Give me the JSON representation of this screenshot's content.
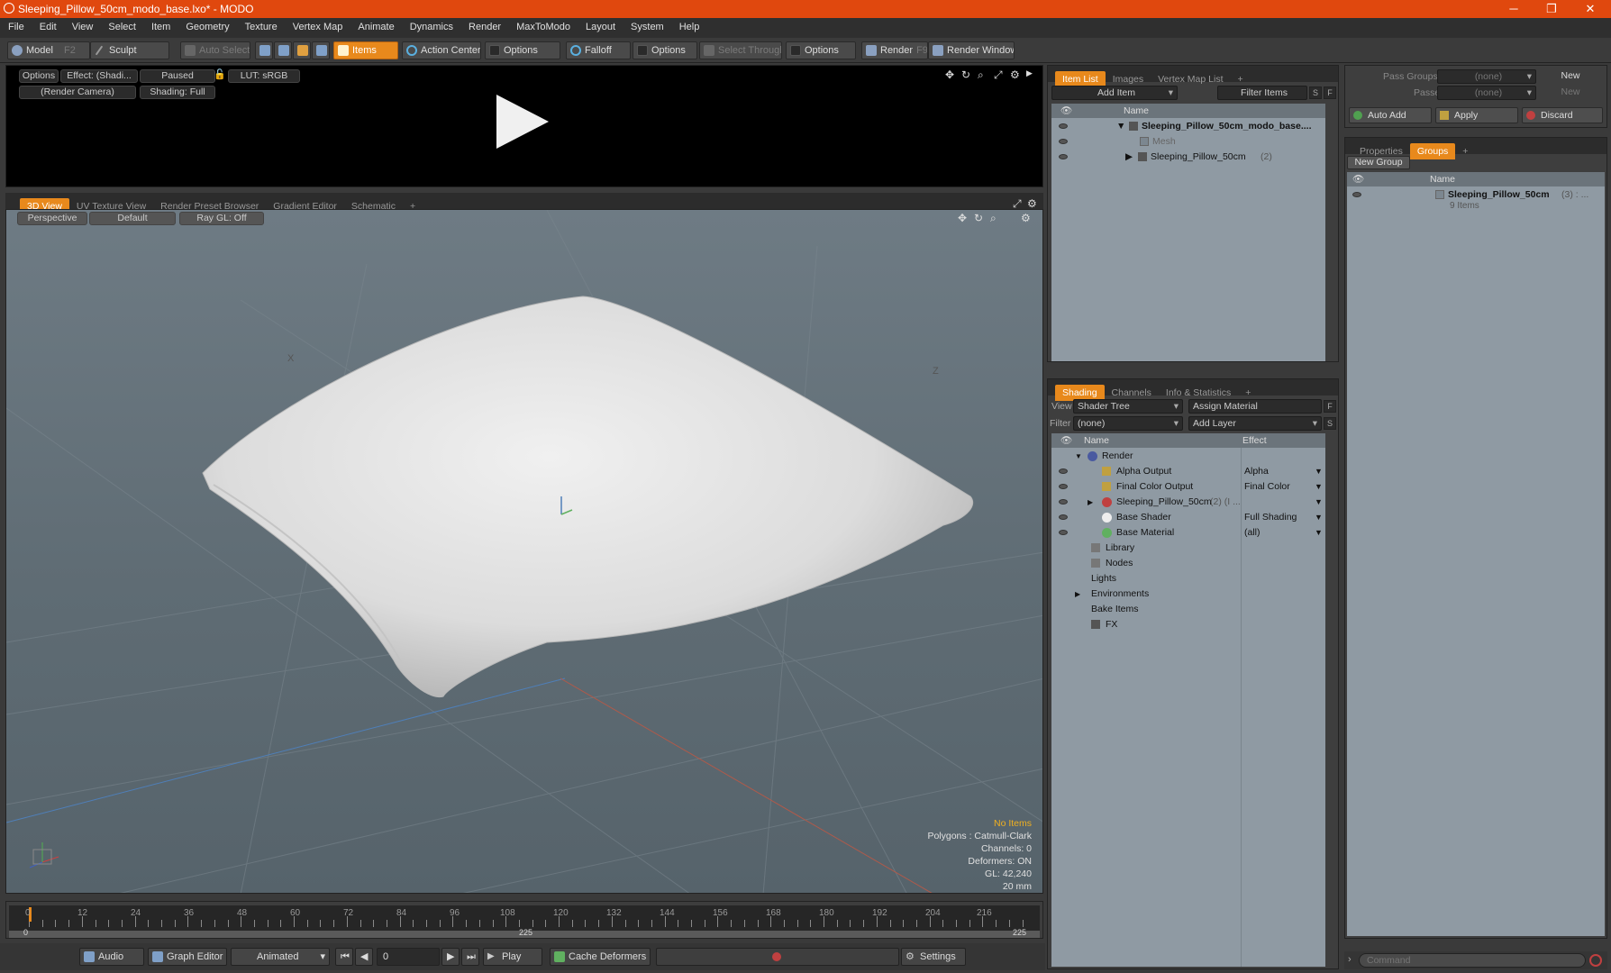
{
  "window": {
    "title": "Sleeping_Pillow_50cm_modo_base.lxo* - MODO",
    "minimize": "─",
    "restore": "❐",
    "close": "✕"
  },
  "menu": [
    "File",
    "Edit",
    "View",
    "Select",
    "Item",
    "Geometry",
    "Texture",
    "Vertex Map",
    "Animate",
    "Dynamics",
    "Render",
    "MaxToModo",
    "Layout",
    "System",
    "Help"
  ],
  "toolbar": {
    "model": "Model",
    "model_key": "F2",
    "sculpt": "Sculpt",
    "auto_select": "Auto Select",
    "items": "Items",
    "action_center": "Action Center",
    "options1": "Options",
    "falloff": "Falloff",
    "options2": "Options",
    "select_through": "Select Through",
    "options3": "Options",
    "render": "Render",
    "render_key": "F9",
    "render_window": "Render Window"
  },
  "preview": {
    "options": "Options",
    "effect": "Effect: (Shadi...",
    "paused": "Paused",
    "lut": "LUT: sRGB",
    "camera": "(Render Camera)",
    "shading": "Shading: Full"
  },
  "viewtabs": {
    "view3d": "3D View",
    "uv": "UV Texture View",
    "rpb": "Render Preset Browser",
    "gradient": "Gradient Editor",
    "schematic": "Schematic",
    "add": "+"
  },
  "viewport": {
    "perspective": "Perspective",
    "default": "Default",
    "raygl": "Ray GL: Off",
    "axis_x": "X",
    "axis_z": "Z",
    "stats": {
      "items": "No Items",
      "polygons": "Polygons : Catmull-Clark",
      "channels": "Channels: 0",
      "deformers": "Deformers: ON",
      "gl": "GL: 42,240",
      "size": "20 mm"
    }
  },
  "timeline": {
    "ticks": [
      "0",
      "12",
      "24",
      "36",
      "48",
      "60",
      "72",
      "84",
      "96",
      "108",
      "120",
      "132",
      "144",
      "156",
      "168",
      "180",
      "192",
      "204",
      "216"
    ],
    "start": "0",
    "mid": "225",
    "end": "225"
  },
  "bottombar": {
    "audio": "Audio",
    "graph_editor": "Graph Editor",
    "animated": "Animated",
    "frame": "0",
    "play": "Play",
    "cache": "Cache Deformers",
    "settings": "Settings"
  },
  "itemlist": {
    "tabs": [
      "Item List",
      "Images",
      "Vertex Map List",
      "+"
    ],
    "add_item": "Add Item",
    "filter_items": "Filter Items",
    "s": "S",
    "f": "F",
    "col_name": "Name",
    "rows": [
      {
        "label": "Sleeping_Pillow_50cm_modo_base....",
        "bold": true
      },
      {
        "label": "Mesh",
        "dim": true
      },
      {
        "label": "Sleeping_Pillow_50cm",
        "suffix": "(2)"
      }
    ]
  },
  "shading": {
    "tabs": [
      "Shading",
      "Channels",
      "Info & Statistics",
      "+"
    ],
    "view_label": "View",
    "view_value": "Shader Tree",
    "assign": "Assign Material",
    "filter_label": "Filter",
    "filter_value": "(none)",
    "add_layer": "Add Layer",
    "f": "F",
    "s": "S",
    "col_name": "Name",
    "col_effect": "Effect",
    "rows": [
      {
        "label": "Render",
        "effect": ""
      },
      {
        "label": "Alpha Output",
        "effect": "Alpha"
      },
      {
        "label": "Final Color Output",
        "effect": "Final Color"
      },
      {
        "label": "Sleeping_Pillow_50cm",
        "suffix": "(2) (I ...",
        "effect": ""
      },
      {
        "label": "Base Shader",
        "effect": "Full Shading"
      },
      {
        "label": "Base Material",
        "effect": "(all)"
      },
      {
        "label": "Library",
        "effect": ""
      },
      {
        "label": "Nodes",
        "effect": ""
      },
      {
        "label": "Lights",
        "effect": ""
      },
      {
        "label": "Environments",
        "effect": ""
      },
      {
        "label": "Bake Items",
        "effect": ""
      },
      {
        "label": "FX",
        "effect": ""
      }
    ]
  },
  "passes": {
    "pass_groups": "Pass Groups",
    "pass_value": "(none)",
    "new1": "New",
    "passes": "Passes",
    "passes_value": "(none)",
    "new2": "New",
    "auto_add": "Auto Add",
    "apply": "Apply",
    "discard": "Discard"
  },
  "groups": {
    "tabs": [
      "Properties",
      "Groups",
      "+"
    ],
    "new_group": "New Group",
    "col_name": "Name",
    "row_label": "Sleeping_Pillow_50cm",
    "row_suffix": "(3) : ...",
    "row_sub": "9 Items"
  },
  "command": {
    "placeholder": "Command"
  },
  "colors": {
    "accent": "#e8891c",
    "titlebar": "#e0480e",
    "viewport": "#66737b"
  }
}
